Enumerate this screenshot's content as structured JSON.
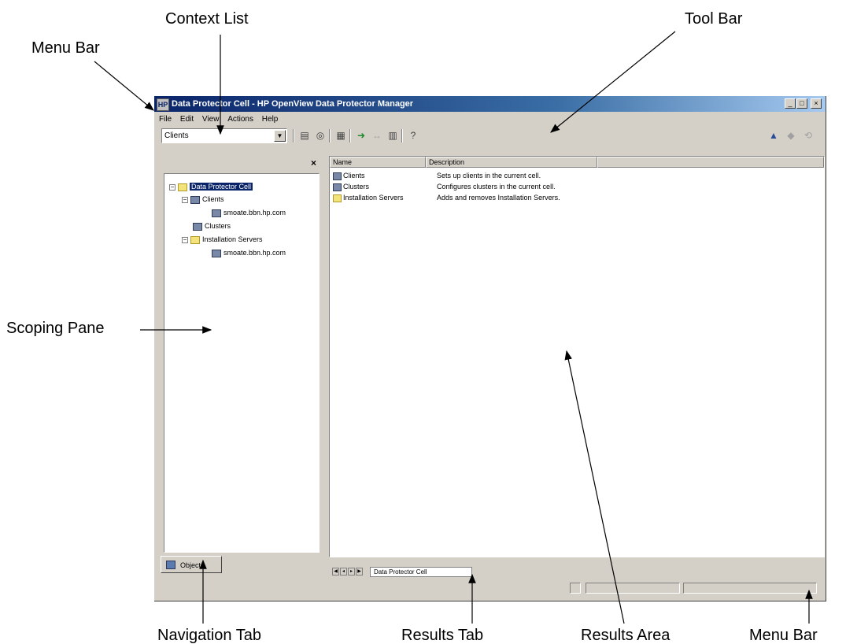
{
  "callouts": {
    "context_list": "Context List",
    "tool_bar": "Tool Bar",
    "menu_bar_top": "Menu Bar",
    "scoping_pane": "Scoping Pane",
    "navigation_tab": "Navigation Tab",
    "results_tab": "Results Tab",
    "results_area": "Results Area",
    "menu_bar_bottom": "Menu Bar"
  },
  "window": {
    "title": "Data Protector Cell - HP OpenView Data Protector Manager",
    "icon_text": "HP",
    "minimize": "_",
    "maximize": "□",
    "close": "×"
  },
  "menu": [
    "File",
    "Edit",
    "View",
    "Actions",
    "Help"
  ],
  "context_list": {
    "value": "Clients",
    "dropdown_glyph": "▼"
  },
  "toolbar_icons": {
    "add_client": "▤",
    "disk": "◎",
    "list": "▦",
    "import": "➜",
    "export": "↔",
    "properties": "▥",
    "help": "?",
    "right_1": "▲",
    "right_2": "◆",
    "right_3": "⟲"
  },
  "scoping_pane": {
    "close_glyph": "×",
    "tree": {
      "root": "Data Protector Cell",
      "clients": "Clients",
      "client_host": "smoate.bbn.hp.com",
      "clusters": "Clusters",
      "installation_servers": "Installation Servers",
      "install_host": "smoate.bbn.hp.com"
    },
    "expand_glyph": "−"
  },
  "navigation_tab": {
    "label": "Objects"
  },
  "results": {
    "columns": [
      "Name",
      "Description"
    ],
    "rows": [
      {
        "name": "Clients",
        "description": "Sets up clients in the current cell."
      },
      {
        "name": "Clusters",
        "description": "Configures clusters in the current cell."
      },
      {
        "name": "Installation Servers",
        "description": "Adds and removes Installation Servers."
      }
    ]
  },
  "results_tab": {
    "label": "Data Protector Cell"
  },
  "colors": {
    "title_bar": "#0a246a",
    "face": "#d4d0c8",
    "selection": "#0a246a"
  }
}
